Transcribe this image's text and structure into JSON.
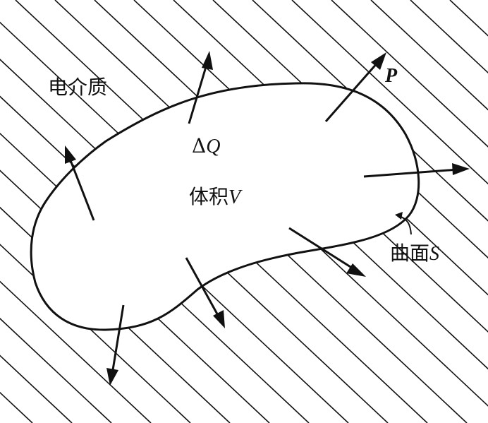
{
  "labels": {
    "dielectric": "电介质",
    "charge_prefix": "Δ",
    "charge_symbol": "Q",
    "volume_prefix": "体积",
    "volume_symbol": "V",
    "polarization_symbol": "P",
    "surface_prefix": "曲面",
    "surface_symbol": "S"
  },
  "colors": {
    "ink": "#111111",
    "background": "#ffffff"
  }
}
